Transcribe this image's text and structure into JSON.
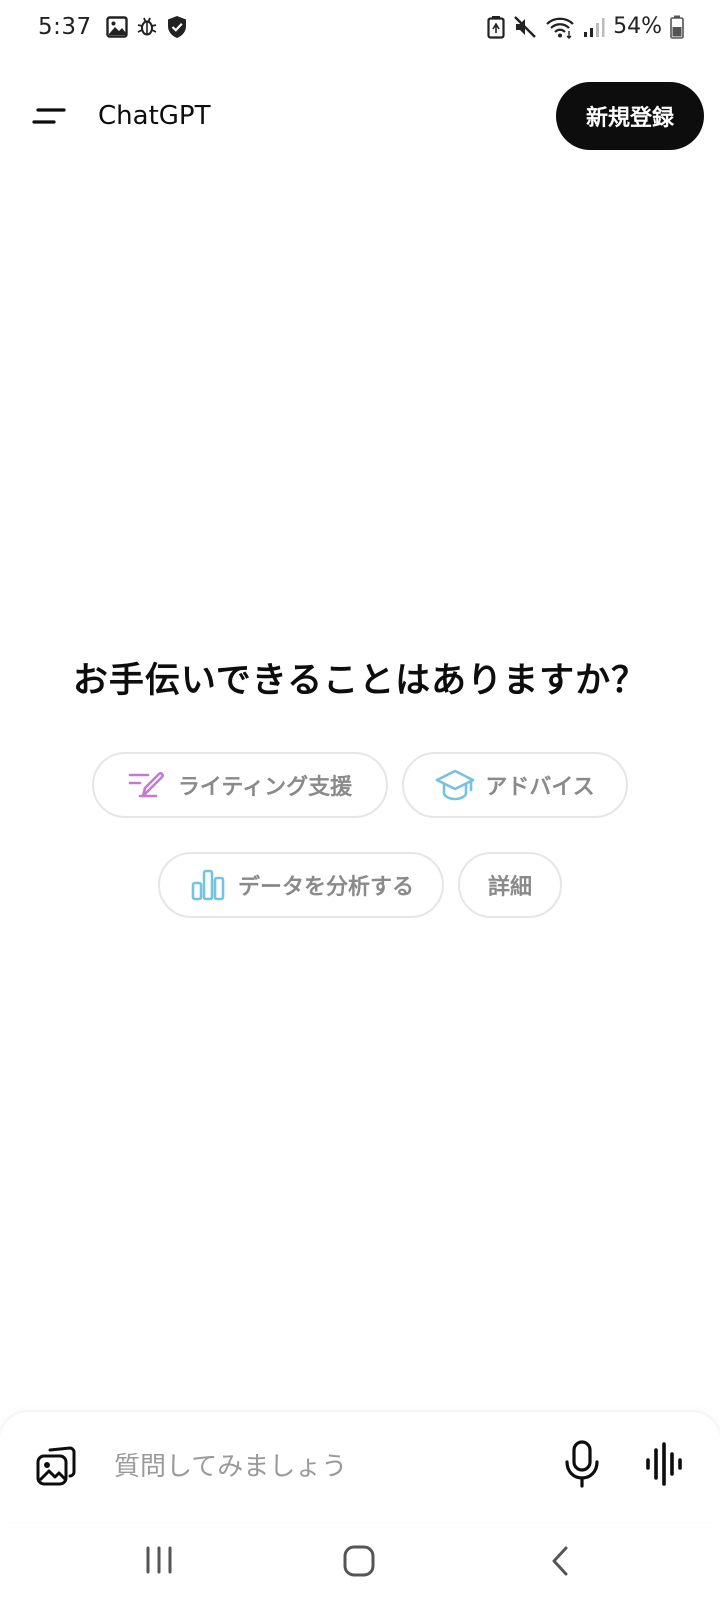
{
  "status_bar": {
    "time": "5:37",
    "battery": "54%",
    "icons_left": [
      "gallery-icon",
      "bug-icon",
      "shield-icon"
    ],
    "icons_right": [
      "battery-saver-icon",
      "mute-icon",
      "wifi-icon",
      "signal-icon",
      "battery-icon"
    ]
  },
  "header": {
    "title": "ChatGPT",
    "signup_label": "新規登録"
  },
  "main": {
    "headline": "お手伝いできることはありますか？",
    "suggestions": [
      {
        "label": "ライティング支援",
        "icon": "pen-icon",
        "color": "#c47ad1"
      },
      {
        "label": "アドバイス",
        "icon": "graduation-cap-icon",
        "color": "#74c3e0"
      },
      {
        "label": "データを分析する",
        "icon": "bar-chart-icon",
        "color": "#74c3e0"
      },
      {
        "label": "詳細",
        "icon": ""
      }
    ]
  },
  "composer": {
    "placeholder": "質問してみましょう"
  },
  "nav": {
    "items": [
      "recents",
      "home",
      "back"
    ]
  }
}
